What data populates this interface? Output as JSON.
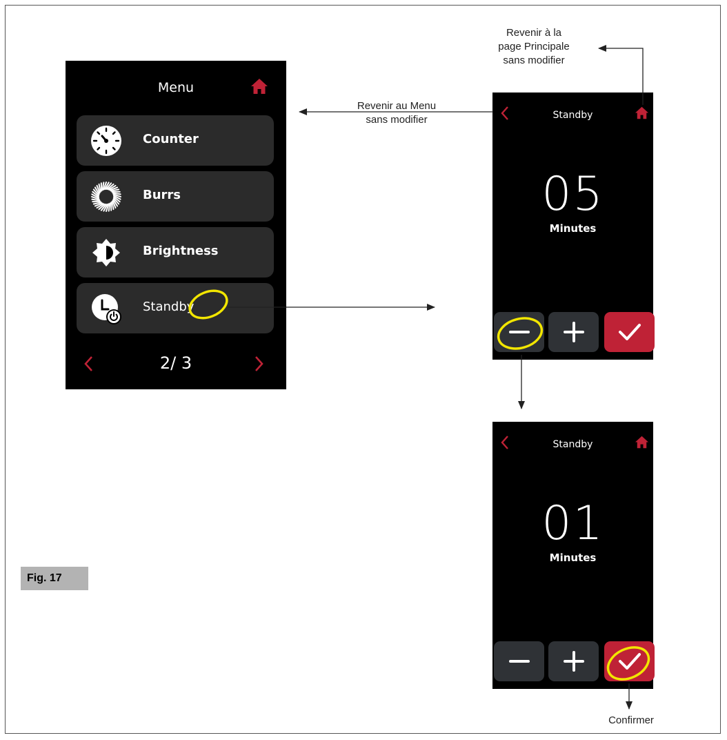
{
  "colors": {
    "accent": "#bf2236",
    "button_bg": "#2b2b2b",
    "highlight": "#f2e600"
  },
  "menu_screen": {
    "title": "Menu",
    "items": [
      {
        "label": "Counter",
        "icon": "counter-dial-icon"
      },
      {
        "label": "Burrs",
        "icon": "burrs-icon"
      },
      {
        "label": "Brightness",
        "icon": "brightness-icon"
      },
      {
        "label": "Standby",
        "icon": "standby-clock-icon"
      }
    ],
    "page_indicator": "2/ 3"
  },
  "standby_screen_1": {
    "title": "Standby",
    "value": "05",
    "unit": "Minutes"
  },
  "standby_screen_2": {
    "title": "Standby",
    "value": "01",
    "unit": "Minutes"
  },
  "annotations": {
    "home_note": "Revenir à la page Principale sans modifier",
    "home_note_lines": [
      "Revenir à la",
      "page Principale",
      "sans modifier"
    ],
    "back_note_lines": [
      "Revenir au Menu",
      "sans modifier"
    ],
    "confirm_note": "Confirmer"
  },
  "figure_label": "Fig. 17"
}
